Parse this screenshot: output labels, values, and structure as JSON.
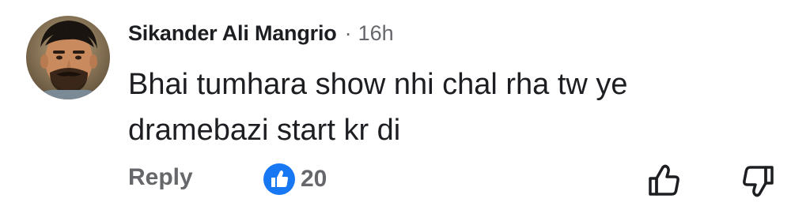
{
  "comment": {
    "author": "Sikander Ali Mangrio",
    "separator": "·",
    "timestamp": "16h",
    "text": "Bhai tumhara show nhi chal rha tw ye dramebazi start kr di"
  },
  "actions": {
    "reply_label": "Reply",
    "like_count": "20",
    "reaction_icon": "like-icon",
    "upvote_icon": "thumbs-up-icon",
    "downvote_icon": "thumbs-down-icon"
  },
  "colors": {
    "text_primary": "#1c1e21",
    "text_secondary": "#65676b",
    "like_blue": "#1877f2"
  }
}
